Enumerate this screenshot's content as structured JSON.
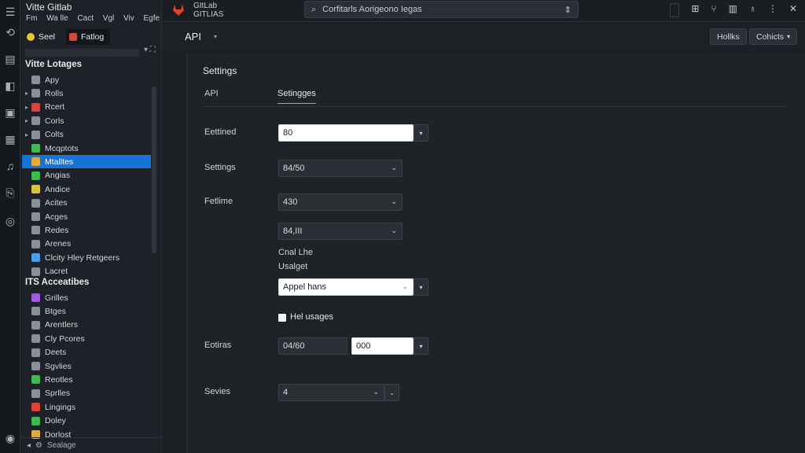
{
  "sidebar": {
    "brand": "Vitte  Gitlab",
    "menu": [
      "Fm",
      "Wa lle",
      "Cact",
      "Vgl",
      "Viv",
      "Egfe"
    ],
    "tabs": [
      {
        "label": "Seel"
      },
      {
        "label": "Fatlog"
      }
    ],
    "sections": [
      {
        "title": "Vitte Lotages",
        "items": [
          {
            "label": "Apy",
            "twisty": "",
            "icon_color": "#8a9099"
          },
          {
            "label": "Rolls",
            "twisty": "▸",
            "icon_color": "#8a9099"
          },
          {
            "label": "Rcert",
            "twisty": "▸",
            "icon_color": "#d9453b"
          },
          {
            "label": "Corls",
            "twisty": "▸",
            "icon_color": "#8a9099"
          },
          {
            "label": "Colts",
            "twisty": "▸",
            "icon_color": "#8a9099"
          },
          {
            "label": "Mcqptots",
            "twisty": "",
            "icon_color": "#3fb950"
          },
          {
            "label": "Mtalltes",
            "twisty": "",
            "icon_color": "#e4a93b",
            "selected": true
          },
          {
            "label": "Angias",
            "twisty": "",
            "icon_color": "#3fb950"
          },
          {
            "label": "Andice",
            "twisty": "",
            "icon_color": "#d6c53b"
          },
          {
            "label": "Acites",
            "twisty": "",
            "icon_color": "#8a9099"
          },
          {
            "label": "Acges",
            "twisty": "",
            "icon_color": "#8a9099"
          },
          {
            "label": "Redes",
            "twisty": "",
            "icon_color": "#8a9099"
          },
          {
            "label": "Arenes",
            "twisty": "",
            "icon_color": "#8a9099"
          },
          {
            "label": "Clcity Hley Retgeers",
            "twisty": "",
            "icon_color": "#4f9de8"
          },
          {
            "label": "Lacret",
            "twisty": "",
            "icon_color": "#8a9099"
          }
        ]
      },
      {
        "title": "ITS Acceatibes",
        "items": [
          {
            "label": "Grilles",
            "twisty": "",
            "icon_color": "#a05ae0"
          },
          {
            "label": "Btges",
            "twisty": "",
            "icon_color": "#8a9099"
          },
          {
            "label": "Arentlers",
            "twisty": "",
            "icon_color": "#8a9099"
          },
          {
            "label": "Cly Pcores",
            "twisty": "",
            "icon_color": "#8a9099"
          },
          {
            "label": "Deets",
            "twisty": "",
            "icon_color": "#8a9099"
          },
          {
            "label": "Sgvlies",
            "twisty": "",
            "icon_color": "#8a9099"
          },
          {
            "label": "Reotles",
            "twisty": "",
            "icon_color": "#3fb950"
          },
          {
            "label": "Sprlles",
            "twisty": "",
            "icon_color": "#8a9099"
          },
          {
            "label": "Lingings",
            "twisty": "",
            "icon_color": "#d9453b"
          },
          {
            "label": "Doley",
            "twisty": "",
            "icon_color": "#3fb950"
          },
          {
            "label": "Dorlost",
            "twisty": "",
            "icon_color": "#e4a93b"
          }
        ]
      }
    ],
    "footer": "Sealage"
  },
  "titlebar": {
    "app_name_1": "GItLab",
    "app_name_2": "GITLIAS",
    "command_text": "Corfitarls Aorigeono Iegas"
  },
  "header": {
    "title": "API",
    "buttons": [
      {
        "label": "Hollks"
      },
      {
        "label": "Cohicts"
      }
    ]
  },
  "panel": {
    "title": "Settings",
    "tabs": [
      {
        "label": "API"
      },
      {
        "label": "Setingges"
      }
    ],
    "labels": {
      "l1": "Eettined",
      "l2": "Settings",
      "l3": "Fetlime",
      "l4": "Eotiras",
      "l5": "Sevies"
    },
    "fields": {
      "f1": "80",
      "f2": "84/50",
      "f3": "430",
      "f4": "84,III",
      "f5": "Appel hans",
      "f6a": "04/60",
      "f6b": "000",
      "f7": "4"
    },
    "text1": "Cnal Lhe",
    "text2": "Usalget",
    "checkbox_label": "Hel usages"
  }
}
